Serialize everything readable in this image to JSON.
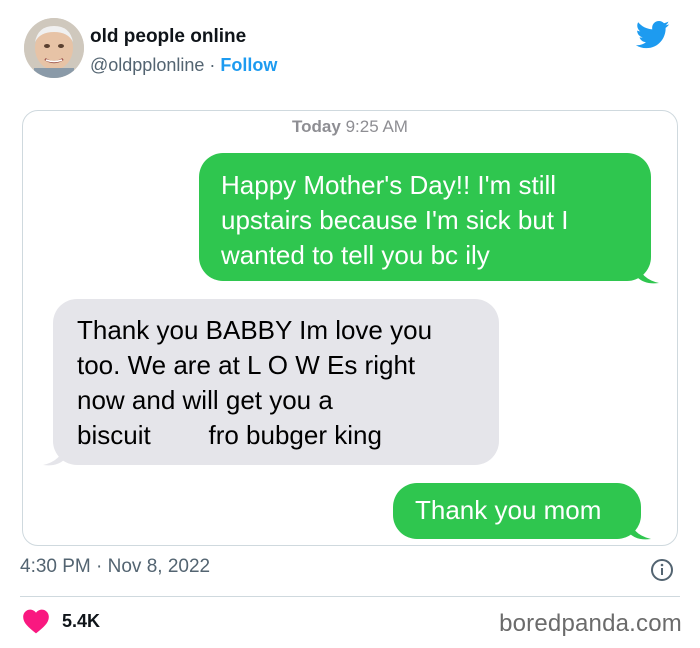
{
  "tweet": {
    "display_name": "old people online",
    "handle": "@oldpplonline",
    "separator": " · ",
    "follow_label": "Follow",
    "timestamp": "4:30 PM · Nov 8, 2022",
    "likes": "5.4K"
  },
  "screenshot": {
    "day": "Today",
    "time": "9:25 AM",
    "messages": [
      {
        "from": "me",
        "text": "Happy Mother's Day!! I'm still\nupstairs because I'm sick but I\nwanted to tell you bc ily"
      },
      {
        "from": "mom",
        "text": "Thank you BABBY Im love you\ntoo. We are at L O W Es right\nnow and will get you a\nbiscuit        fro bubger king"
      },
      {
        "from": "me",
        "text": "Thank you mom"
      }
    ]
  },
  "watermark": "boredpanda.com",
  "colors": {
    "accent": "#1d9bf0",
    "sent_bubble": "#2fc64f",
    "received_bubble": "#e5e5ea",
    "like": "#f91880"
  },
  "icons": [
    "avatar",
    "twitter-bird-icon",
    "info-icon",
    "heart-icon"
  ]
}
